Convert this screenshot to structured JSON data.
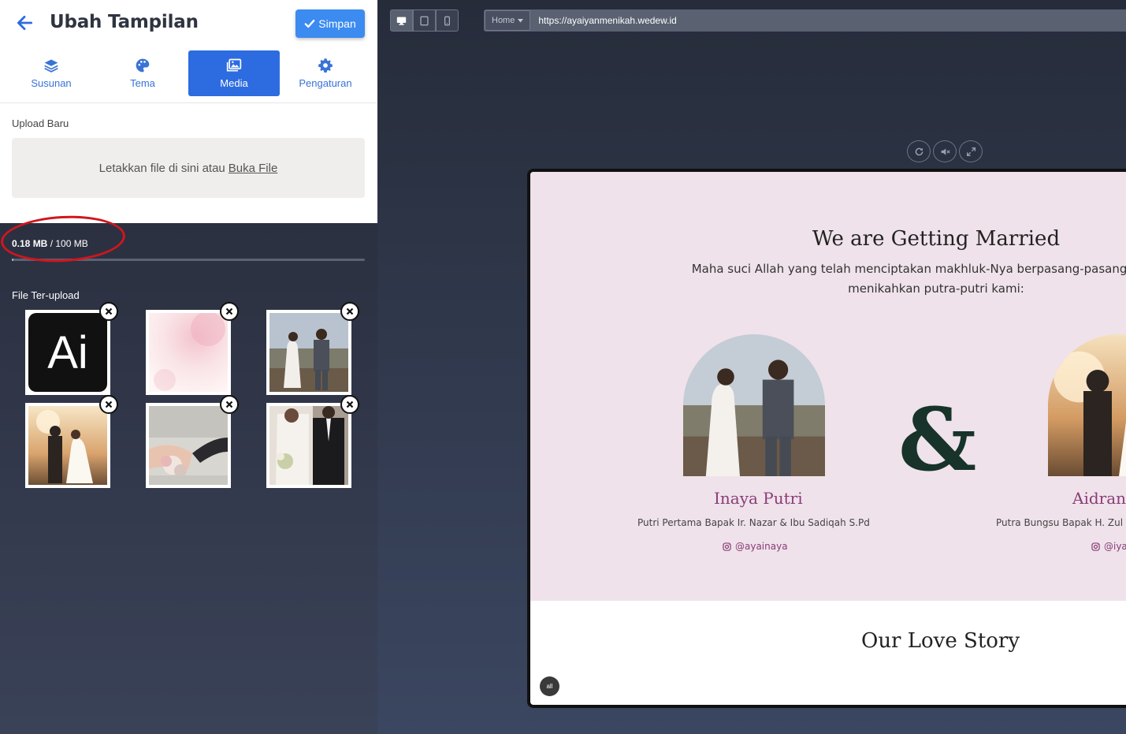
{
  "header": {
    "title": "Ubah Tampilan",
    "save_label": "Simpan"
  },
  "tabs": [
    {
      "label": "Susunan",
      "icon": "layers-icon"
    },
    {
      "label": "Tema",
      "icon": "palette-icon"
    },
    {
      "label": "Media",
      "icon": "images-icon",
      "active": true
    },
    {
      "label": "Pengaturan",
      "icon": "gear-icon"
    }
  ],
  "upload": {
    "label": "Upload Baru",
    "drop_text": "Letakkan file di sini atau",
    "drop_link": "Buka File"
  },
  "storage": {
    "used": "0.18 MB",
    "total": "100 MB",
    "fraction_used": 0.0018
  },
  "files": {
    "label": "File Ter-upload",
    "items": [
      {
        "name": "ai-logo-image",
        "logo_text": "Ai"
      },
      {
        "name": "pink-watercolor-image"
      },
      {
        "name": "couple-holding-hands-image"
      },
      {
        "name": "couple-sunset-image"
      },
      {
        "name": "rings-image"
      },
      {
        "name": "bride-groom-image"
      }
    ]
  },
  "preview": {
    "page_select": "Home",
    "url": "https://ayaiyanmenikah.wedew.id",
    "devices": [
      "desktop-icon",
      "tablet-icon",
      "mobile-icon"
    ],
    "controls": [
      "refresh-icon",
      "mute-icon",
      "expand-icon"
    ]
  },
  "invitation": {
    "title": "We are Getting Married",
    "desc_line1": "Maha suci Allah yang telah menciptakan makhluk-Nya berpasang-pasangan. Ya All",
    "desc_line2": "menikahkan putra-putri kami:",
    "ampersand": "&",
    "bride": {
      "name": "Inaya Putri",
      "parents": "Putri Pertama Bapak Ir. Nazar & Ibu Sadiqah S.Pd",
      "instagram": "@ayainaya"
    },
    "groom": {
      "name": "Aidran",
      "parents": "Putra Bungsu Bapak H. Zul",
      "instagram": "@iya"
    },
    "story_title": "Our Love Story",
    "badge": "all"
  },
  "colors": {
    "accent": "#2d6ce0",
    "save_button": "#3b8bf0",
    "invitation_bg": "#efe2ea",
    "name_color": "#8a3c78",
    "annotation_circle": "#d0161e"
  }
}
